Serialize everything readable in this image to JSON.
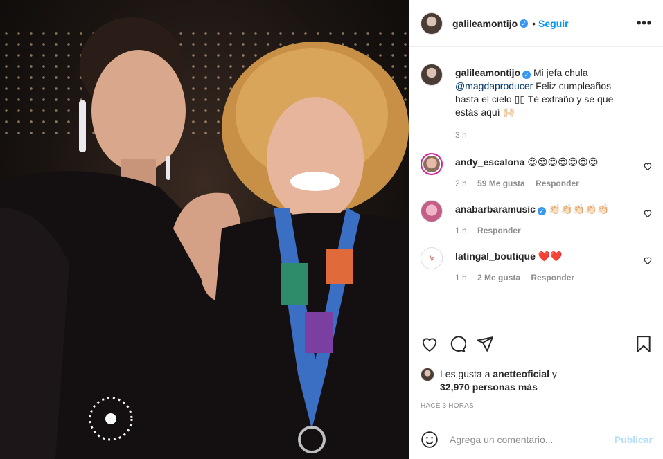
{
  "post": {
    "username": "galileamontijo",
    "follow_label": "Seguir",
    "more_label": "•••",
    "separator": "•",
    "photo_alt": "Foto de galileamontijo"
  },
  "caption": {
    "username": "galileamontijo",
    "line1": "Mi jefa chula",
    "mention": "@magdaproducer",
    "line2": " Feliz cumpleaños hasta el cielo ",
    "line3": " Té extraño y se que estás aquí ",
    "time": "3 h"
  },
  "comments": [
    {
      "username": "andy_escalona",
      "text": "😍😍😍😍😍😍😍",
      "time": "2 h",
      "likes": "59 Me gusta",
      "reply": "Responder"
    },
    {
      "username": "anabarbaramusic",
      "text": "👏🏻👏🏻👏🏻👏🏻👏🏻",
      "time": "1 h",
      "reply": "Responder"
    },
    {
      "username": "latingal_boutique",
      "text": "❤️❤️",
      "time": "1 h",
      "likes": "2 Me gusta",
      "reply": "Responder"
    }
  ],
  "likes": {
    "prefix": "Les gusta a ",
    "user": "anetteoficial",
    "middle": " y",
    "count": "32,970 personas más"
  },
  "timestamp": "HACE 3 HORAS",
  "composer": {
    "placeholder": "Agrega un comentario...",
    "publish_label": "Publicar"
  },
  "colors": {
    "link": "#0095f6",
    "verified": "#3897f0",
    "publish_disabled": "#b2dffc",
    "muted": "#8e8e8e"
  },
  "icons": [
    "more-icon",
    "verified-icon",
    "heart-icon",
    "comment-icon",
    "share-icon",
    "bookmark-icon",
    "emoji-icon"
  ]
}
